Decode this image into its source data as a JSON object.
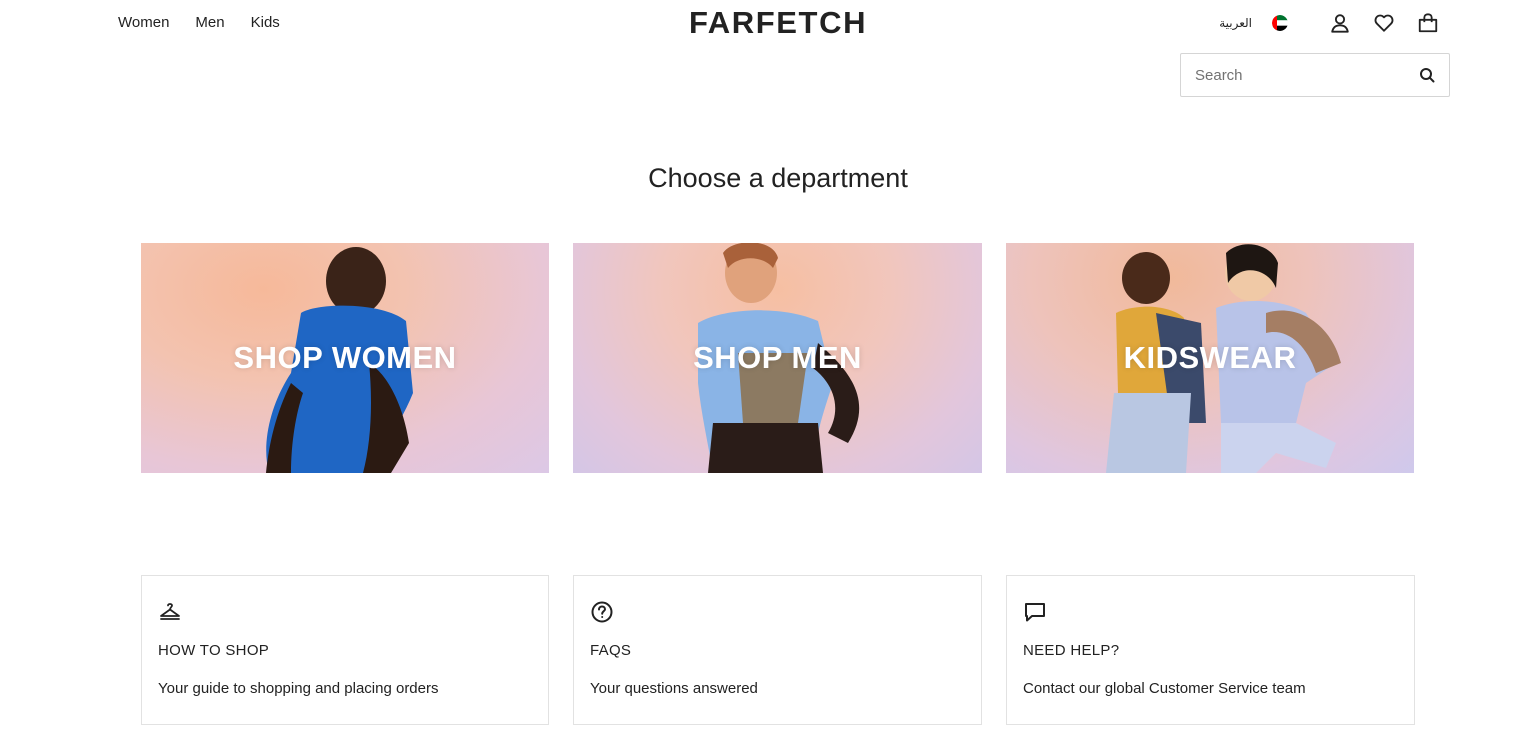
{
  "header": {
    "nav": [
      {
        "label": "Women"
      },
      {
        "label": "Men"
      },
      {
        "label": "Kids"
      }
    ],
    "logo": "FARFETCH",
    "language_label": "العربية",
    "flag": "uae-flag-icon",
    "icons": [
      "account-icon",
      "wishlist-heart-icon",
      "shopping-bag-icon"
    ]
  },
  "search": {
    "placeholder": "Search",
    "value": ""
  },
  "main": {
    "title": "Choose a department",
    "departments": [
      {
        "label": "SHOP WOMEN"
      },
      {
        "label": "SHOP MEN"
      },
      {
        "label": "KIDSWEAR"
      }
    ],
    "info_cards": [
      {
        "icon": "hanger-icon",
        "title": "HOW TO SHOP",
        "description": "Your guide to shopping and placing orders"
      },
      {
        "icon": "question-circle-icon",
        "title": "FAQS",
        "description": "Your questions answered"
      },
      {
        "icon": "chat-bubble-icon",
        "title": "NEED HELP?",
        "description": "Contact our global Customer Service team"
      }
    ]
  },
  "colors": {
    "text": "#222222",
    "border": "#e2e2e2",
    "background": "#ffffff"
  }
}
